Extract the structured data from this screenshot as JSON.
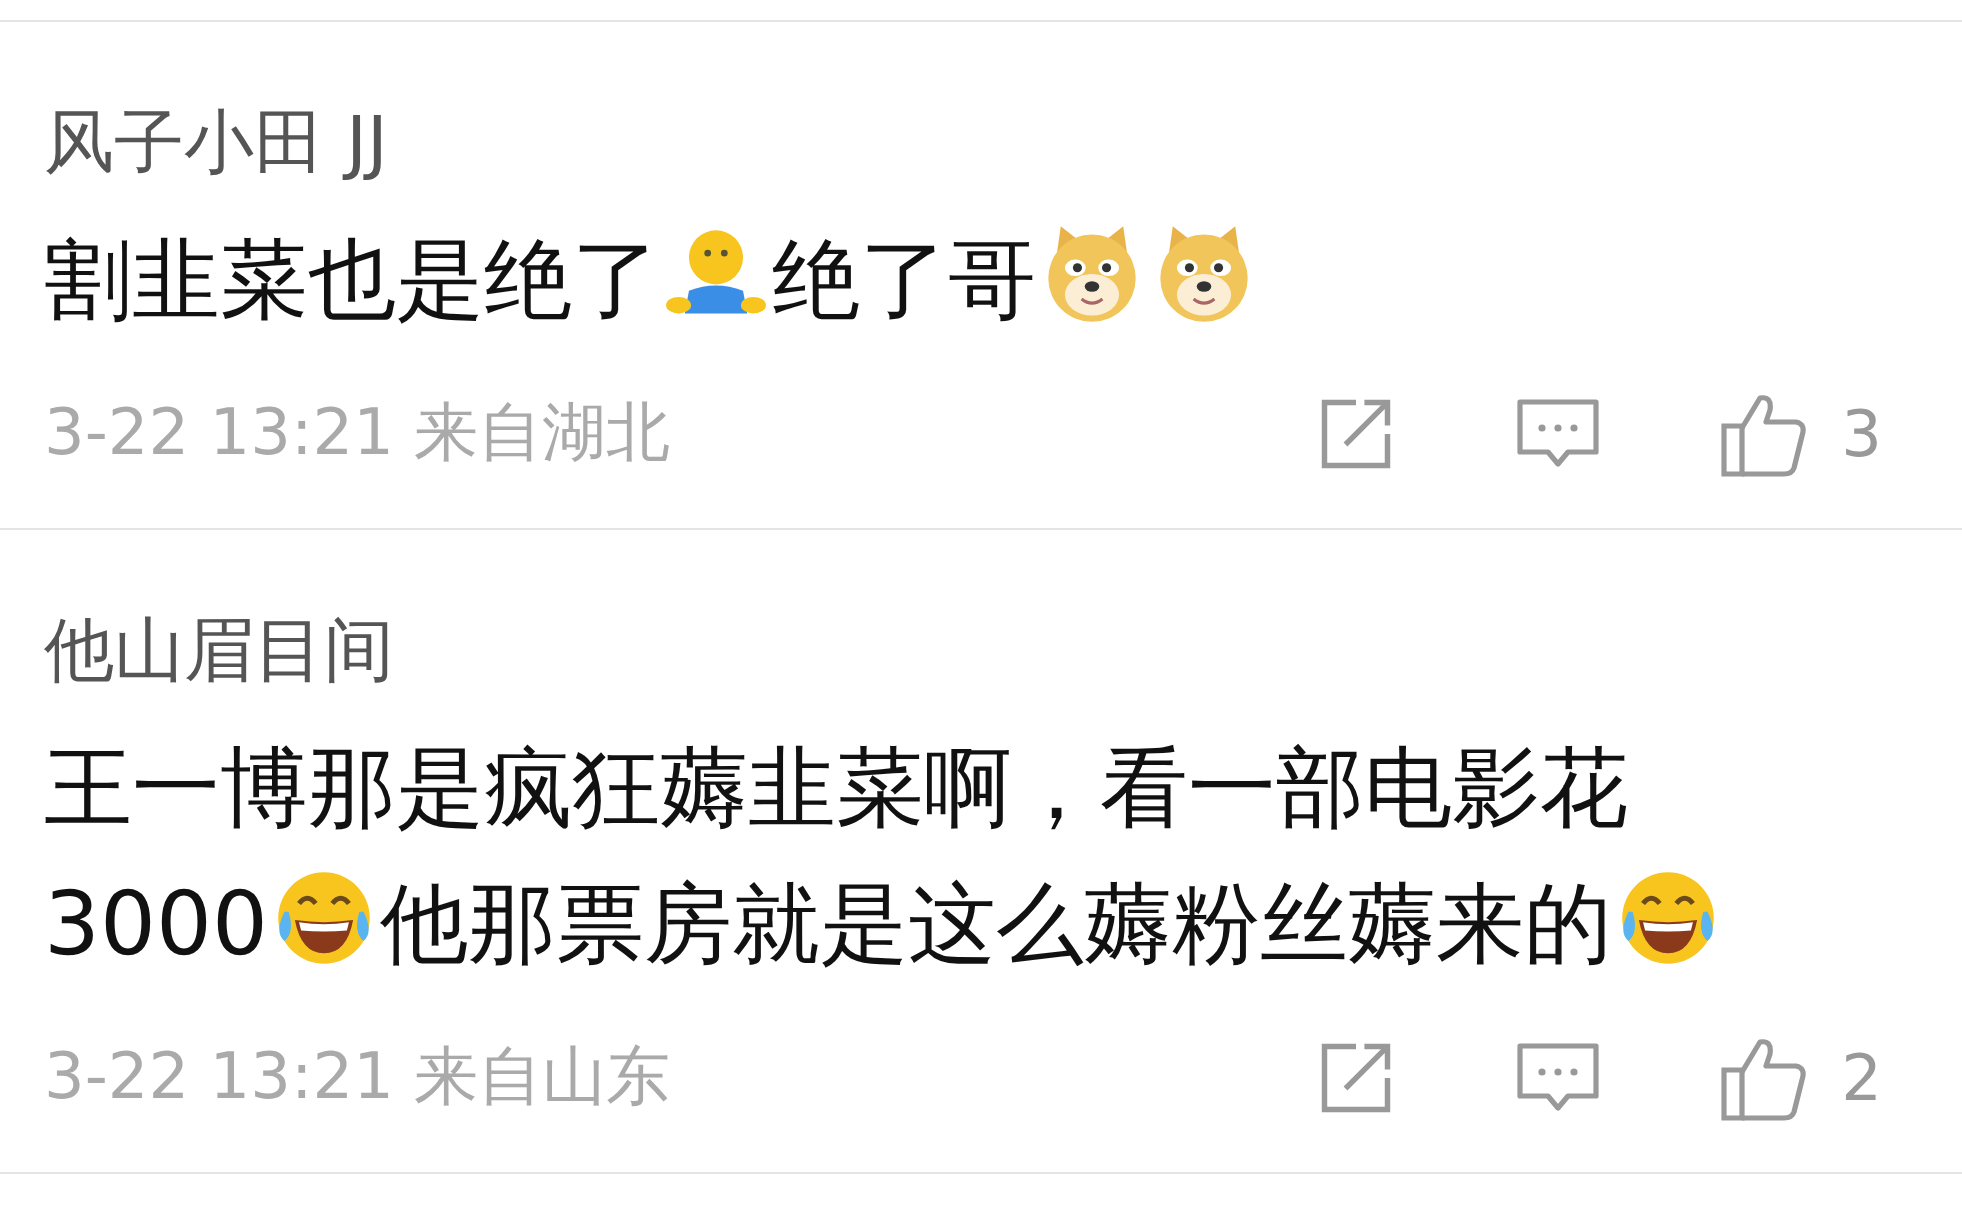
{
  "comments": [
    {
      "username": "风子小田 JJ",
      "content": [
        {
          "kind": "text",
          "text": "割韭菜也是绝了"
        },
        {
          "kind": "figure"
        },
        {
          "kind": "text",
          "text": "绝了哥"
        },
        {
          "kind": "dog"
        },
        {
          "kind": "dog"
        }
      ],
      "meta": "3-22 13:21 来自湖北",
      "likes": "3"
    },
    {
      "username": "他山眉目间",
      "content": [
        {
          "kind": "text",
          "text": "王一博那是疯狂薅韭菜啊，看一部电影花"
        },
        {
          "kind": "text",
          "text": "3000"
        },
        {
          "kind": "laugh"
        },
        {
          "kind": "text",
          "text": "他那票房就是这么薅粉丝薅来的"
        },
        {
          "kind": "laugh"
        }
      ],
      "meta": "3-22 13:21 来自山东",
      "likes": "2"
    }
  ]
}
